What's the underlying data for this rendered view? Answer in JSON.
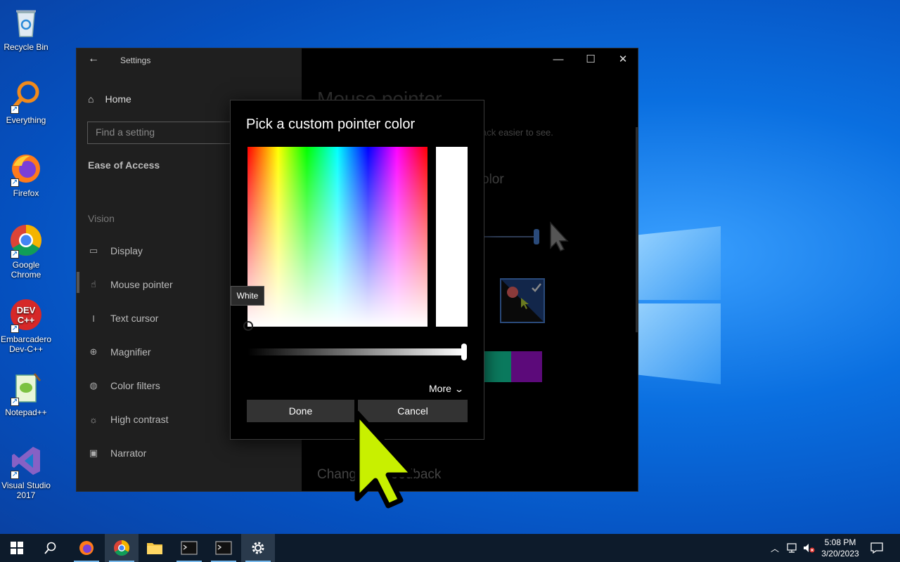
{
  "desktop": {
    "icons": [
      {
        "label": "Recycle Bin"
      },
      {
        "label": "Everything"
      },
      {
        "label": "Firefox"
      },
      {
        "label": "Google Chrome"
      },
      {
        "label": "Embarcadero Dev-C++"
      },
      {
        "label": "Notepad++"
      },
      {
        "label": "Visual Studio 2017"
      }
    ],
    "devcpp_badge_top": "DEV",
    "devcpp_badge_bottom": "C++"
  },
  "settings": {
    "window_title": "Settings",
    "home_label": "Home",
    "search_placeholder": "Find a setting",
    "section_heading": "Ease of Access",
    "vision_heading": "Vision",
    "nav_items": [
      {
        "label": "Display",
        "icon": "display-icon"
      },
      {
        "label": "Mouse pointer",
        "icon": "mouse-pointer-icon"
      },
      {
        "label": "Text cursor",
        "icon": "text-cursor-icon"
      },
      {
        "label": "Magnifier",
        "icon": "magnifier-icon"
      },
      {
        "label": "Color filters",
        "icon": "color-filters-icon"
      },
      {
        "label": "High contrast",
        "icon": "high-contrast-icon"
      },
      {
        "label": "Narrator",
        "icon": "narrator-icon"
      }
    ],
    "main": {
      "title": "Mouse pointer",
      "desc_fragment": "ack easier to see.",
      "sub_fragment": "olor",
      "feedback": "Change ... Feedback"
    },
    "swatches": [
      "#0b7a5e",
      "#5c0a7a"
    ]
  },
  "dialog": {
    "title": "Pick a custom pointer color",
    "tooltip": "White",
    "more_label": "More",
    "done_label": "Done",
    "cancel_label": "Cancel",
    "selected_color": "#ffffff",
    "brightness": 1.0
  },
  "taskbar": {
    "time": "5:08 PM",
    "date": "3/20/2023"
  },
  "colors": {
    "accent": "#76b9ed",
    "pointer_yellow": "#c8f000"
  }
}
